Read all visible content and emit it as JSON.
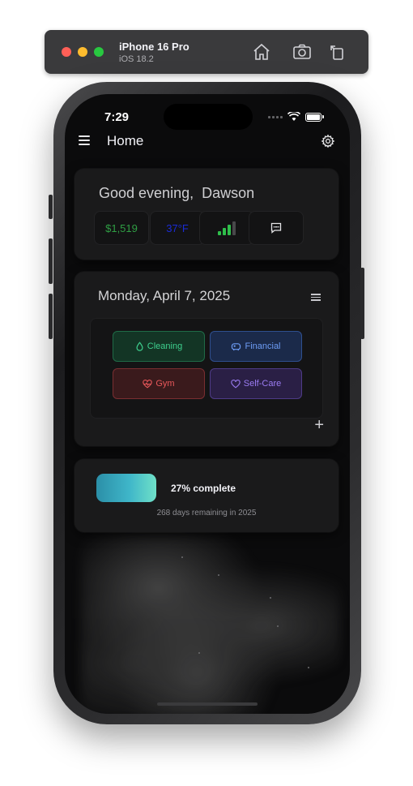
{
  "simulator": {
    "device_name": "iPhone 16 Pro",
    "os_version": "iOS 18.2",
    "icons": [
      "home-icon",
      "screenshot-icon",
      "rotate-icon"
    ]
  },
  "status_bar": {
    "time": "7:29"
  },
  "nav": {
    "title": "Home"
  },
  "greeting_card": {
    "greeting": "Good evening,",
    "name": "Dawson",
    "balance": "$1,519",
    "temperature": "37°F",
    "balance_color": "#2f9e44",
    "temperature_color": "#1a2bd6"
  },
  "date_card": {
    "date": "Monday, April 7, 2025",
    "categories": [
      {
        "label": "Cleaning",
        "icon": "drop-icon",
        "color": "#3ecf8e"
      },
      {
        "label": "Financial",
        "icon": "piggy-bank-icon",
        "color": "#5b8def"
      },
      {
        "label": "Gym",
        "icon": "heart-pulse-icon",
        "color": "#e8575a"
      },
      {
        "label": "Self-Care",
        "icon": "heart-icon",
        "color": "#9b7cf2"
      }
    ]
  },
  "progress_card": {
    "percent": 27,
    "complete_text": "27% complete",
    "days_remaining_text": "268 days remaining in 2025"
  }
}
